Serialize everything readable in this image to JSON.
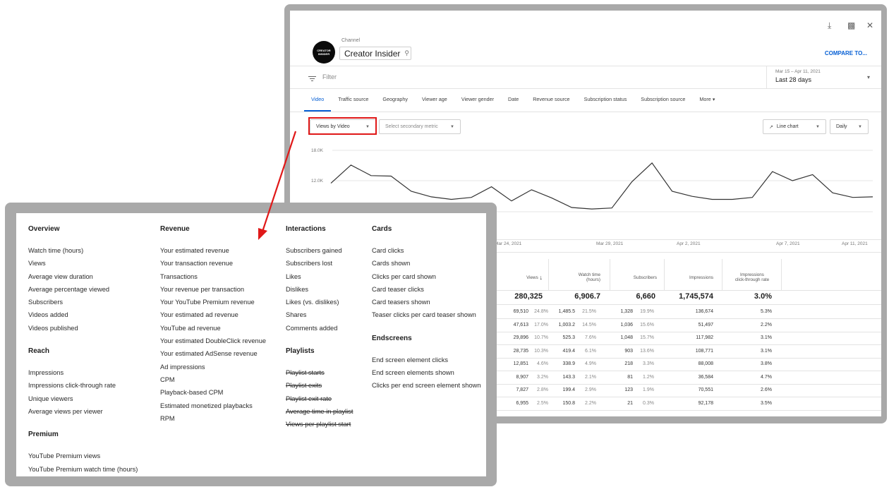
{
  "channel": {
    "label": "Channel",
    "name": "Creator Insider",
    "avatar_text": "CREATOR INSIDER"
  },
  "toolbar": {
    "compare_label": "COMPARE TO..."
  },
  "filter": {
    "placeholder": "Filter"
  },
  "date": {
    "range": "Mar 15 – Apr 11, 2021",
    "label": "Last 28 days"
  },
  "tabs": [
    "Video",
    "Traffic source",
    "Geography",
    "Viewer age",
    "Viewer gender",
    "Date",
    "Revenue source",
    "Subscription status",
    "Subscription source",
    "More"
  ],
  "controls": {
    "primary_metric": "Views by Video",
    "secondary_metric": "Select secondary metric",
    "chart_type": "Line chart",
    "interval": "Daily"
  },
  "chart_data": {
    "type": "line",
    "y_ticks": [
      "18.0K",
      "12.0K"
    ],
    "x_ticks": [
      "Mar 24, 2021",
      "Mar 29, 2021",
      "Apr 2, 2021",
      "Apr 7, 2021",
      "Apr 11, 2021"
    ],
    "values": [
      11500,
      15100,
      13000,
      12900,
      9900,
      8800,
      8300,
      8700,
      10800,
      8000,
      10200,
      8600,
      6700,
      6400,
      6600,
      11800,
      15500,
      9900,
      8900,
      8300,
      8300,
      8700,
      13800,
      12000,
      13200,
      9600,
      8700,
      8800
    ],
    "ylim": [
      0,
      21000
    ]
  },
  "table": {
    "headers": [
      "Views",
      "Watch time (hours)",
      "Subscribers",
      "Impressions",
      "Impressions click-through rate"
    ],
    "sort_indicator": "↓",
    "totals": [
      "280,325",
      "6,906.7",
      "6,660",
      "1,745,574",
      "3.0%"
    ],
    "rows": [
      [
        "69,510",
        "24.8%",
        "1,485.5",
        "21.5%",
        "1,328",
        "19.9%",
        "136,674",
        "5.3%"
      ],
      [
        "47,613",
        "17.0%",
        "1,003.2",
        "14.5%",
        "1,036",
        "15.6%",
        "51,497",
        "2.2%"
      ],
      [
        "29,896",
        "10.7%",
        "525.3",
        "7.6%",
        "1,048",
        "15.7%",
        "117,982",
        "3.1%"
      ],
      [
        "28,735",
        "10.3%",
        "419.4",
        "6.1%",
        "903",
        "13.6%",
        "108,771",
        "3.1%"
      ],
      [
        "12,851",
        "4.6%",
        "338.9",
        "4.9%",
        "218",
        "3.3%",
        "88,008",
        "3.8%"
      ],
      [
        "8,907",
        "3.2%",
        "143.3",
        "2.1%",
        "81",
        "1.2%",
        "36,584",
        "4.7%"
      ],
      [
        "7,827",
        "2.8%",
        "199.4",
        "2.9%",
        "123",
        "1.9%",
        "70,551",
        "2.6%"
      ],
      [
        "6,955",
        "2.5%",
        "150.8",
        "2.2%",
        "21",
        "0.3%",
        "92,178",
        "3.5%"
      ]
    ]
  },
  "menu": {
    "overview": {
      "title": "Overview",
      "items": [
        "Watch time (hours)",
        "Views",
        "Average view duration",
        "Average percentage viewed",
        "Subscribers",
        "Videos added",
        "Videos published"
      ]
    },
    "reach": {
      "title": "Reach",
      "items": [
        "Impressions",
        "Impressions click-through rate",
        "Unique viewers",
        "Average views per viewer"
      ]
    },
    "premium": {
      "title": "Premium",
      "items": [
        "YouTube Premium views",
        "YouTube Premium watch time (hours)"
      ]
    },
    "revenue": {
      "title": "Revenue",
      "items": [
        "Your estimated revenue",
        "Your transaction revenue",
        "Transactions",
        "Your revenue per transaction",
        "Your YouTube Premium revenue",
        "Your estimated ad revenue",
        "YouTube ad revenue",
        "Your estimated DoubleClick revenue",
        "Your estimated AdSense revenue",
        "Ad impressions",
        "CPM",
        "Playback-based CPM",
        "Estimated monetized playbacks",
        "RPM"
      ]
    },
    "interactions": {
      "title": "Interactions",
      "items": [
        "Subscribers gained",
        "Subscribers lost",
        "Likes",
        "Dislikes",
        "Likes (vs. dislikes)",
        "Shares",
        "Comments added"
      ]
    },
    "playlists": {
      "title": "Playlists",
      "items": [
        "Playlist starts",
        "Playlist exits",
        "Playlist exit rate",
        "Average time in playlist",
        "Views per playlist start"
      ]
    },
    "cards": {
      "title": "Cards",
      "items": [
        "Card clicks",
        "Cards shown",
        "Clicks per card shown",
        "Card teaser clicks",
        "Card teasers shown",
        "Teaser clicks per card teaser shown"
      ]
    },
    "endscreens": {
      "title": "Endscreens",
      "items": [
        "End screen element clicks",
        "End screen elements shown",
        "Clicks per end screen element shown"
      ]
    }
  },
  "colors": {
    "accent": "#065fd4",
    "highlight": "#e01818",
    "frame": "#a9a9a9"
  },
  "icons": [
    "download-icon",
    "feedback-icon",
    "close-icon",
    "search-icon",
    "filter-icon",
    "trend-icon"
  ]
}
